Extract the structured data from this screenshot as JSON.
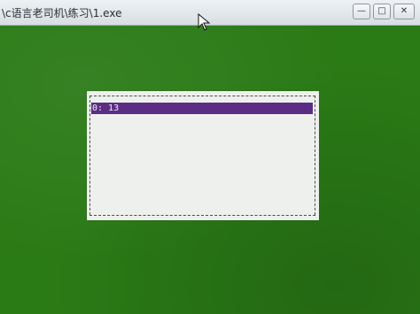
{
  "window": {
    "title": "\\c语言老司机\\练习\\1.exe",
    "minimize_glyph": "—",
    "maximize_glyph": "□",
    "close_glyph": "✕"
  },
  "console": {
    "background_color": "#2a7a16",
    "menu": {
      "items": [
        {
          "text": "0: 13",
          "selected": true,
          "highlight_color": "#5b2d84"
        }
      ]
    }
  },
  "icons": {
    "cursor": "mouse-cursor-icon"
  }
}
